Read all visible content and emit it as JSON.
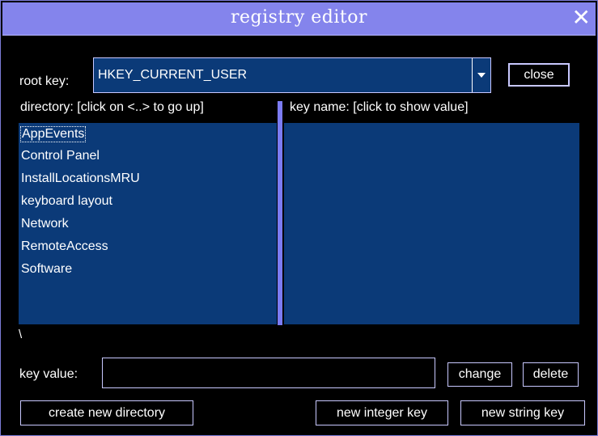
{
  "window": {
    "title": "registry editor",
    "close_glyph": "✕"
  },
  "root_key": {
    "label": "root key:",
    "value": "HKEY_CURRENT_USER"
  },
  "buttons": {
    "close": "close",
    "change": "change",
    "delete": "delete",
    "create_directory": "create new directory",
    "new_integer_key": "new integer key",
    "new_string_key": "new string key"
  },
  "directory": {
    "header": "directory: [click on <..> to go up]",
    "items": [
      {
        "label": "AppEvents",
        "selected": true
      },
      {
        "label": "Control Panel"
      },
      {
        "label": "InstallLocationsMRU"
      },
      {
        "label": "keyboard layout"
      },
      {
        "label": "Network"
      },
      {
        "label": "RemoteAccess"
      },
      {
        "label": "Software"
      }
    ],
    "current_path": "\\"
  },
  "keys": {
    "header": "key name: [click to show value]",
    "items": []
  },
  "key_value": {
    "label": "key value:",
    "value": ""
  },
  "colors": {
    "titlebar": "#8484ec",
    "panel": "#0b3a78",
    "splitter": "#7c7cf4",
    "border": "#c8c8ff"
  }
}
